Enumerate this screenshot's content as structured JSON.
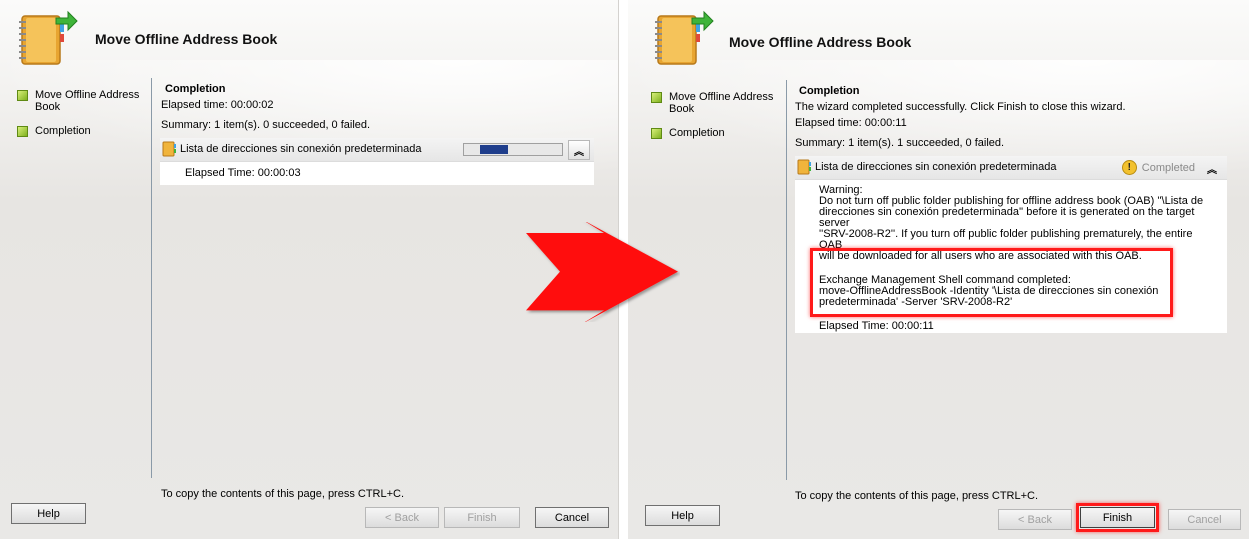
{
  "left": {
    "title": "Move Offline Address Book",
    "steps": [
      "Move Offline Address Book",
      "Completion"
    ],
    "heading": "Completion",
    "elapsed": "Elapsed time: 00:00:02",
    "summary": "Summary: 1 item(s). 0 succeeded, 0 failed.",
    "task": {
      "name": "Lista de direcciones sin conexión predeterminada",
      "progress": 0.35,
      "elapsed": "Elapsed Time: 00:00:03"
    },
    "footer": "To copy the contents of this page, press CTRL+C.",
    "buttons": {
      "help": "Help",
      "back": "< Back",
      "finish": "Finish",
      "cancel": "Cancel"
    }
  },
  "right": {
    "title": "Move Offline Address Book",
    "steps": [
      "Move Offline Address Book",
      "Completion"
    ],
    "heading": "Completion",
    "success": "The wizard completed successfully. Click Finish to close this wizard.",
    "elapsed": "Elapsed time: 00:00:11",
    "summary": "Summary: 1 item(s). 1 succeeded, 0 failed.",
    "task": {
      "name": "Lista de direcciones sin conexión predeterminada",
      "status": "Completed",
      "warning_label": "Warning:",
      "warning_lines": [
        "Do not turn off public folder publishing for offline address book (OAB) ''\\Lista de",
        "direcciones sin conexión predeterminada'' before it is generated on the target server",
        "''SRV-2008-R2''. If you turn off public folder publishing prematurely, the entire OAB",
        "will be downloaded for all users who are associated with this OAB."
      ],
      "command_label": "Exchange Management Shell command completed:",
      "command_lines": [
        "move-OfflineAddressBook -Identity '\\Lista de direcciones sin conexión",
        "predeterminada' -Server 'SRV-2008-R2'"
      ],
      "elapsed": "Elapsed Time: 00:00:11"
    },
    "footer": "To copy the contents of this page, press CTRL+C.",
    "buttons": {
      "help": "Help",
      "back": "< Back",
      "finish": "Finish",
      "cancel": "Cancel"
    }
  },
  "colors": {
    "highlight": "#ff1a1a",
    "arrow": "#ff1010",
    "progress": "#1f3e8c",
    "step": "#8cc63f"
  },
  "icons": {
    "wizard": "address-book-move-icon",
    "task": "address-book-icon",
    "step": "step-bullet-icon",
    "warning": "warning-icon",
    "collapse": "collapse-chevrons-icon"
  }
}
